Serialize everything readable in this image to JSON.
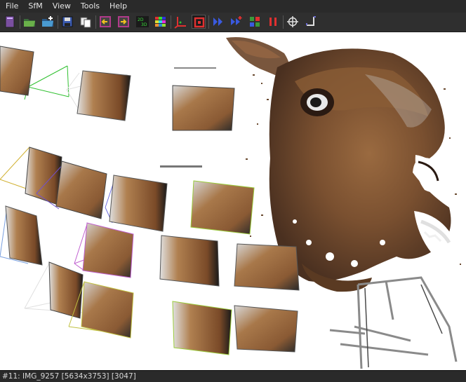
{
  "menu": {
    "items": [
      {
        "label": "File",
        "name": "menu-file"
      },
      {
        "label": "SfM",
        "name": "menu-sfm"
      },
      {
        "label": "View",
        "name": "menu-view"
      },
      {
        "label": "Tools",
        "name": "menu-tools"
      },
      {
        "label": "Help",
        "name": "menu-help"
      }
    ]
  },
  "toolbar": {
    "buttons": [
      {
        "name": "open-project-icon",
        "color": "#7a4fa0"
      },
      {
        "name": "open-folder-icon",
        "color": "#5a8a3a"
      },
      {
        "name": "add-images-icon",
        "color": "#4a7ab0"
      },
      {
        "name": "save-icon",
        "color": "#4a6ab0"
      },
      {
        "name": "copy-icon",
        "color": "#cfcfcf"
      },
      {
        "name": "import-icon",
        "color": "#b03a8a"
      },
      {
        "name": "export-icon",
        "color": "#b03a8a"
      },
      {
        "name": "toggle-2d-3d-icon",
        "color": "#3aaa3a"
      },
      {
        "name": "color-grid-icon",
        "color": "#2a8ad0"
      },
      {
        "name": "axes-icon",
        "color": "#e03030"
      },
      {
        "name": "camera-frame-icon",
        "color": "#e03030"
      },
      {
        "name": "step-forward-icon",
        "color": "#3a5ae0"
      },
      {
        "name": "fast-forward-icon",
        "color": "#3a5ae0"
      },
      {
        "name": "run-sfm-icon",
        "color": "#3a9a3a"
      },
      {
        "name": "pause-icon",
        "color": "#e03030"
      },
      {
        "name": "crosshair-icon",
        "color": "#e0e0e0"
      },
      {
        "name": "resize-icon",
        "color": "#6a6ad0"
      }
    ]
  },
  "status": {
    "text": "#11: IMG_9257 [5634x3753] [3047]"
  }
}
